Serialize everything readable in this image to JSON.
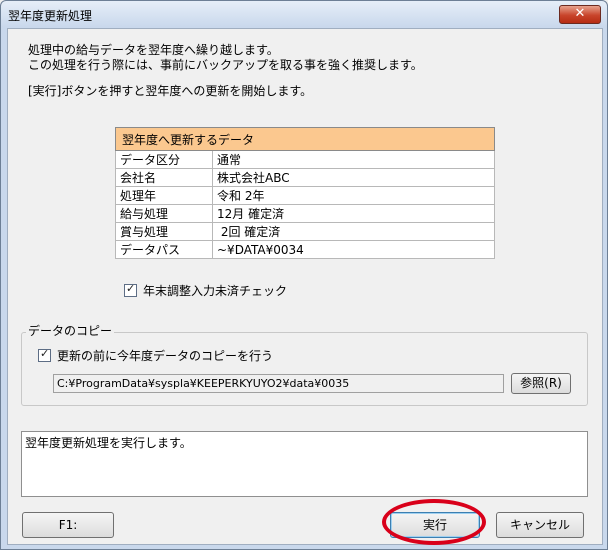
{
  "window": {
    "title": "翌年度更新処理",
    "close_glyph": "✕"
  },
  "messages": [
    "処理中の給与データを翌年度へ繰り越します。",
    "この処理を行う際には、事前にバックアップを取る事を強く推奨します。",
    "[実行]ボタンを押すと翌年度への更新を開始します。"
  ],
  "info_table": {
    "header": "翌年度へ更新するデータ",
    "rows": [
      {
        "key": "データ区分",
        "value": "通常"
      },
      {
        "key": "会社名",
        "value": "株式会社ABC"
      },
      {
        "key": "処理年",
        "value": "令和 2年"
      },
      {
        "key": "給与処理",
        "value": "12月 確定済"
      },
      {
        "key": "賞与処理",
        "value": " 2回 確定済"
      },
      {
        "key": "データパス",
        "value": "~¥DATA¥0034"
      }
    ]
  },
  "year_end_check": {
    "label": "年末調整入力未済チェック",
    "checked": true
  },
  "copy_group": {
    "label": "データのコピー",
    "copy_checkbox_label": "更新の前に今年度データのコピーを行う",
    "checked": true,
    "path": "C:¥ProgramData¥syspla¥KEEPERKYUYO2¥data¥0035",
    "browse_label": "参照(R)"
  },
  "log": {
    "text": "翌年度更新処理を実行します。"
  },
  "buttons": {
    "f1": "F1:",
    "run": "実行",
    "cancel": "キャンセル"
  },
  "colors": {
    "table_header": "#fbc88f",
    "highlight_ring": "#d9001a"
  }
}
